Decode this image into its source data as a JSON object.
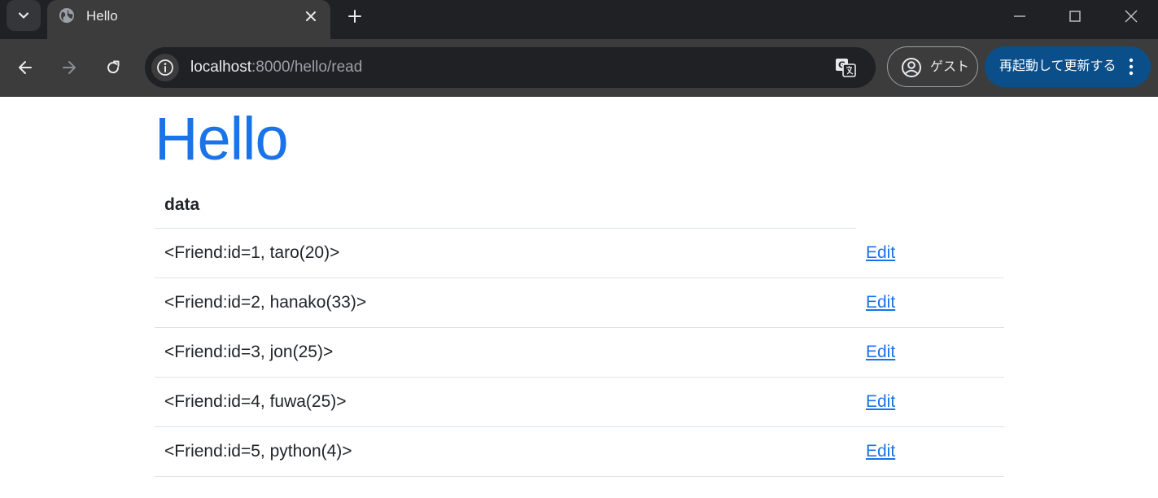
{
  "browser": {
    "tab_title": "Hello",
    "url_host": "localhost",
    "url_rest": ":8000/hello/read",
    "profile_label": "ゲスト",
    "update_label": "再起動して更新する"
  },
  "page": {
    "title": "Hello",
    "table": {
      "header": "data",
      "rows": [
        {
          "label": "<Friend:id=1, taro(20)>",
          "link": "Edit"
        },
        {
          "label": "<Friend:id=2, hanako(33)>",
          "link": "Edit"
        },
        {
          "label": "<Friend:id=3, jon(25)>",
          "link": "Edit"
        },
        {
          "label": "<Friend:id=4, fuwa(25)>",
          "link": "Edit"
        },
        {
          "label": "<Friend:id=5, python(4)>",
          "link": "Edit"
        }
      ]
    }
  },
  "colors": {
    "title": "#1a73e8",
    "link": "#1a73e8",
    "update_button": "#0b4f8a"
  }
}
